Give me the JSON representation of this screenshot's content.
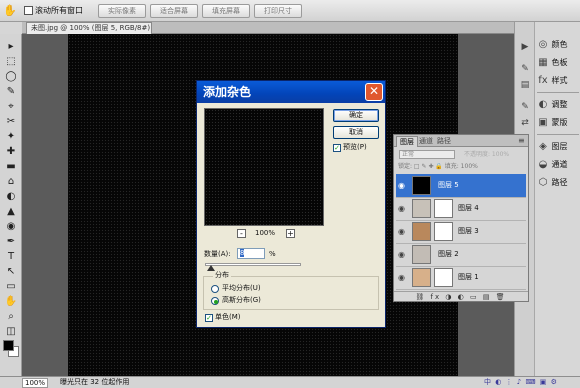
{
  "options_bar": {
    "scroll_all_windows": "滚动所有窗口",
    "buttons": [
      "实际像素",
      "适合屏幕",
      "填充屏幕",
      "打印尺寸"
    ]
  },
  "document_tab": "未图.jpg @ 100% (图层 5, RGB/8#) *",
  "tools": [
    "▸",
    "⬚",
    "◯",
    "✎",
    "⌖",
    "✂",
    "✦",
    "✚",
    "▬",
    "⌂",
    "◐",
    "▲",
    "◉",
    "✒",
    "T",
    "↖",
    "▭",
    "✋",
    "⌕",
    "◫"
  ],
  "status_bar": {
    "zoom": "100%",
    "info": "曝光只在 32 位起作用"
  },
  "dock_col1": [
    "▶",
    "✎",
    "▤",
    "✎",
    "⇄",
    "☰",
    "▦"
  ],
  "dock_col2": [
    {
      "icon": "◎",
      "label": "颜色"
    },
    {
      "icon": "▦",
      "label": "色板"
    },
    {
      "icon": "fx",
      "label": "样式"
    },
    {
      "icon": "◐",
      "label": "调整"
    },
    {
      "icon": "▣",
      "label": "蒙版"
    },
    {
      "icon": "◈",
      "label": "图层"
    },
    {
      "icon": "◒",
      "label": "通道"
    },
    {
      "icon": "⬡",
      "label": "路径"
    }
  ],
  "layers_panel": {
    "tabs": [
      "图层",
      "通道",
      "路径"
    ],
    "blend_mode": "正常",
    "opacity_label": "不透明度: 100%",
    "lock_label": "锁定: □ ✎ ✚ 🔒   填充: 100%",
    "layers": [
      {
        "name": "图层 5",
        "selected": true,
        "thumb": "#000000",
        "mask": false
      },
      {
        "name": "图层 4",
        "selected": false,
        "thumb": "#c7c1b8",
        "mask": true
      },
      {
        "name": "图层 3",
        "selected": false,
        "thumb": "#b9885c",
        "mask": true
      },
      {
        "name": "图层 2",
        "selected": false,
        "thumb": "#c2bcb5",
        "mask": false
      },
      {
        "name": "图层 1",
        "selected": false,
        "thumb": "#d7b08a",
        "mask": true
      }
    ],
    "footer": "⛓ fx ◑ ◐ ▭ ▤ 🗑"
  },
  "dialog": {
    "title": "添加杂色",
    "close": "✕",
    "ok": "确定",
    "cancel": "取消",
    "preview_label": "预览(P)",
    "zoom_out": "-",
    "zoom_in": "+",
    "zoom": "100%",
    "amount_label": "数量(A):",
    "amount_value": "8",
    "percent": "%",
    "distribution_legend": "分布",
    "uniform_label": "平均分布(U)",
    "gaussian_label": "高斯分布(G)",
    "monochromatic_label": "单色(M)",
    "check": "✓"
  },
  "tray": "中 ◐ ⋮ ♪ ⌨ ▣ ⚙"
}
